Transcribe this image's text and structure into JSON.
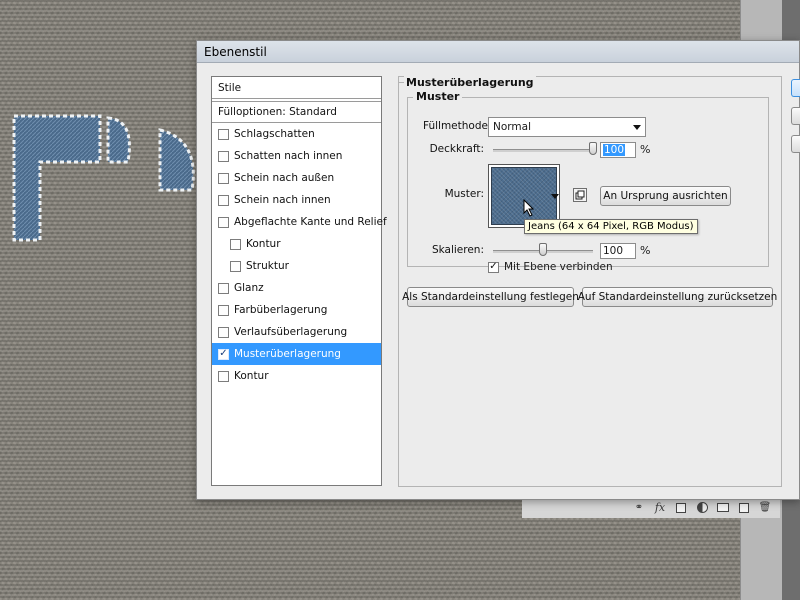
{
  "dialog": {
    "title": "Ebenenstil"
  },
  "styles_list": {
    "header": "Stile",
    "blend_options": "Fülloptionen: Standard",
    "items": [
      {
        "label": "Schlagschatten",
        "checked": false,
        "indent": false,
        "selected": false
      },
      {
        "label": "Schatten nach innen",
        "checked": false,
        "indent": false,
        "selected": false
      },
      {
        "label": "Schein nach außen",
        "checked": false,
        "indent": false,
        "selected": false
      },
      {
        "label": "Schein nach innen",
        "checked": false,
        "indent": false,
        "selected": false
      },
      {
        "label": "Abgeflachte Kante und Relief",
        "checked": false,
        "indent": false,
        "selected": false
      },
      {
        "label": "Kontur",
        "checked": false,
        "indent": true,
        "selected": false
      },
      {
        "label": "Struktur",
        "checked": false,
        "indent": true,
        "selected": false
      },
      {
        "label": "Glanz",
        "checked": false,
        "indent": false,
        "selected": false
      },
      {
        "label": "Farbüberlagerung",
        "checked": false,
        "indent": false,
        "selected": false
      },
      {
        "label": "Verlaufsüberlagerung",
        "checked": false,
        "indent": false,
        "selected": false
      },
      {
        "label": "Musterüberlagerung",
        "checked": true,
        "indent": false,
        "selected": true
      },
      {
        "label": "Kontur",
        "checked": false,
        "indent": false,
        "selected": false
      }
    ]
  },
  "pattern_overlay": {
    "group_title": "Musterüberlagerung",
    "subgroup_title": "Muster",
    "blend_mode_label": "Füllmethode:",
    "blend_mode_value": "Normal",
    "opacity_label": "Deckkraft:",
    "opacity_value": "100",
    "opacity_level": 1.0,
    "percent": "%",
    "pattern_label": "Muster:",
    "snap_button": "An Ursprung ausrichten",
    "tooltip": "Jeans (64 x 64 Pixel, RGB Modus)",
    "scale_label": "Skalieren:",
    "scale_value": "100",
    "scale_level": 0.5,
    "link_label": "Mit Ebene verbinden",
    "link_checked": true,
    "make_default_button": "Als Standardeinstellung festlegen",
    "reset_default_button": "Auf Standardeinstellung zurücksetzen",
    "pattern_color": "#4d6d8e"
  },
  "layers_panel_icons": [
    "link-icon",
    "fx-icon",
    "mask-icon",
    "adjustment-icon",
    "folder-icon",
    "new-layer-icon",
    "trash-icon"
  ]
}
